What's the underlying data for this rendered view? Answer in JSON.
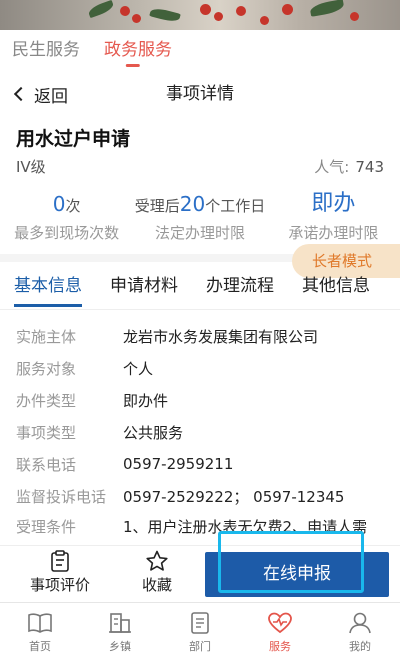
{
  "top_tabs": [
    {
      "label": "民生服务",
      "active": false
    },
    {
      "label": "政务服务",
      "active": true
    }
  ],
  "navbar": {
    "back_label": "返回",
    "title": "事项详情"
  },
  "item": {
    "title": "用水过户申请",
    "level": "IV级",
    "popularity_label": "人气:",
    "popularity_value": "743"
  },
  "stats": [
    {
      "prefix": "",
      "value": "0",
      "suffix": "次",
      "caption": "最多到现场次数"
    },
    {
      "prefix": "受理后",
      "value": "20",
      "suffix": "个工作日",
      "caption": "法定办理时限"
    },
    {
      "prefix": "",
      "value": "即办",
      "suffix": "",
      "caption": "承诺办理时限"
    }
  ],
  "elder_mode_label": "长者模式",
  "sub_tabs": [
    {
      "label": "基本信息",
      "active": true
    },
    {
      "label": "申请材料",
      "active": false
    },
    {
      "label": "办理流程",
      "active": false
    },
    {
      "label": "其他信息",
      "active": false
    }
  ],
  "info": [
    {
      "key": "实施主体",
      "value": "龙岩市水务发展集团有限公司"
    },
    {
      "key": "服务对象",
      "value": "个人"
    },
    {
      "key": "办件类型",
      "value": "即办件"
    },
    {
      "key": "事项类型",
      "value": "公共服务"
    },
    {
      "key": "联系电话",
      "value": "0597-2959211"
    },
    {
      "key": "监督投诉电话",
      "value": "0597-2529222； 0597-12345"
    },
    {
      "key": "受理条件",
      "value": "1、用户注册水表无欠费2、申请人需"
    }
  ],
  "actions": {
    "review_label": "事项评价",
    "collect_label": "收藏",
    "apply_label": "在线申报"
  },
  "tabbar": [
    {
      "label": "首页",
      "icon": "book-icon",
      "active": false
    },
    {
      "label": "乡镇",
      "icon": "building-icon",
      "active": false
    },
    {
      "label": "部门",
      "icon": "document-icon",
      "active": false
    },
    {
      "label": "服务",
      "icon": "heart-icon",
      "active": true
    },
    {
      "label": "我的",
      "icon": "user-icon",
      "active": false
    }
  ],
  "colors": {
    "accent_red": "#e5584e",
    "primary_blue": "#1d5ba8",
    "highlight": "#19b8ec",
    "elder_bg": "#f7e3c8",
    "elder_text": "#e07a2b"
  }
}
